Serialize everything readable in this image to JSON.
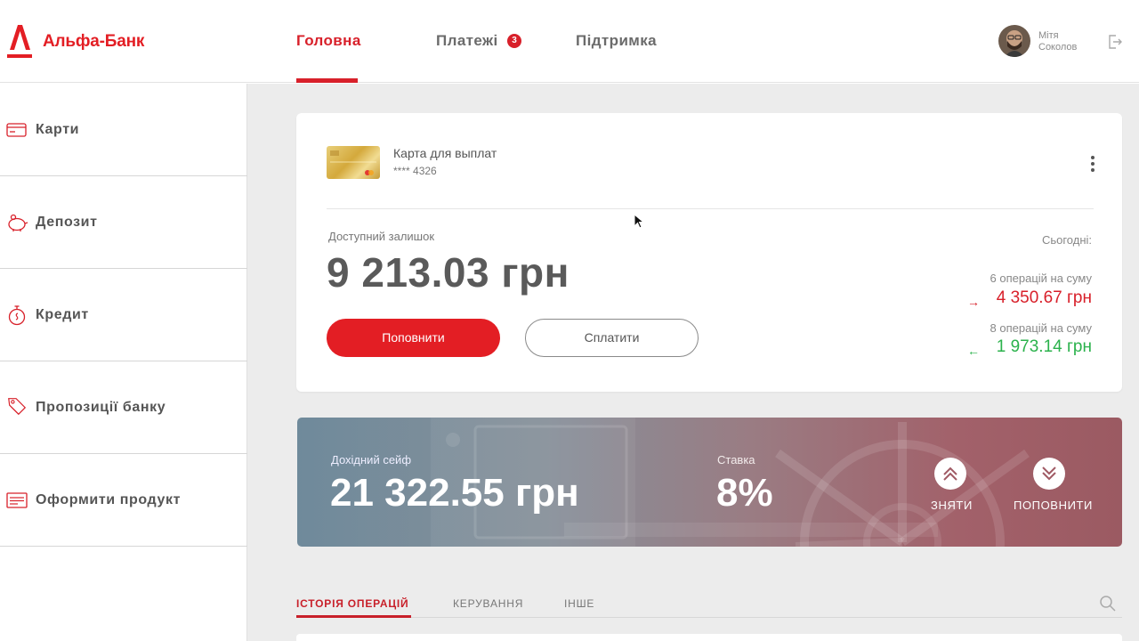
{
  "brand": {
    "name": "Альфа-Банк",
    "color": "#e31e24"
  },
  "nav": {
    "home": "Головна",
    "payments": "Платежі",
    "payments_badge": "3",
    "support": "Підтримка"
  },
  "user": {
    "first_name": "Мітя",
    "last_name": "Соколов"
  },
  "sidebar": {
    "items": [
      {
        "label": "Карти",
        "icon": "card-icon"
      },
      {
        "label": "Депозит",
        "icon": "piggy-bank-icon"
      },
      {
        "label": "Кредит",
        "icon": "stopwatch-icon"
      },
      {
        "label": "Пропозиції банку",
        "icon": "tags-icon"
      },
      {
        "label": "Оформити продукт",
        "icon": "form-icon"
      }
    ]
  },
  "card": {
    "name": "Карта для выплат",
    "number": "**** 4326",
    "balance_label": "Доступний залишок",
    "balance": "9 213.03 грн",
    "topup_button": "Поповнити",
    "pay_button": "Сплатити",
    "today_label": "Сьогодні:",
    "outgoing_ops": "6 операцій на суму",
    "outgoing_amount": "4 350.67 грн",
    "incoming_ops": "8 операцій на суму",
    "incoming_amount": "1 973.14 грн",
    "outgoing_arrow": "→",
    "incoming_arrow": "←"
  },
  "safe": {
    "label": "Дохідний сейф",
    "amount": "21 322.55 грн",
    "rate_label": "Ставка",
    "rate": "8%",
    "withdraw": "ЗНЯТИ",
    "topup": "ПОПОВНИТИ"
  },
  "tabs": {
    "history": "ІСТОРІЯ ОПЕРАЦІЙ",
    "manage": "КЕРУВАННЯ",
    "other": "ІНШЕ"
  },
  "colors": {
    "accent": "#d8202a",
    "income": "#2bb24c"
  }
}
